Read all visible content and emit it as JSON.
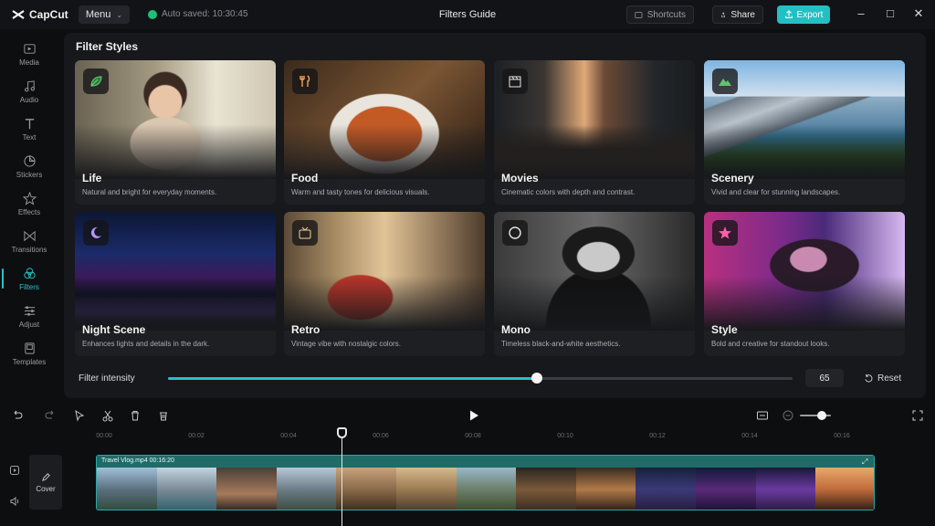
{
  "app": {
    "name": "CapCut",
    "title": "Filters Guide"
  },
  "topbar": {
    "menu_label": "Menu",
    "autosave": "Auto saved: 10:30:45",
    "shortcuts_label": "Shortcuts",
    "share_label": "Share",
    "export_label": "Export"
  },
  "sidebar": {
    "items": [
      {
        "label": "Media",
        "icon": "media-icon"
      },
      {
        "label": "Audio",
        "icon": "audio-icon"
      },
      {
        "label": "Text",
        "icon": "text-icon"
      },
      {
        "label": "Stickers",
        "icon": "stickers-icon"
      },
      {
        "label": "Effects",
        "icon": "effects-icon"
      },
      {
        "label": "Transitions",
        "icon": "transitions-icon"
      },
      {
        "label": "Filters",
        "icon": "filters-icon",
        "active": true
      },
      {
        "label": "Adjust",
        "icon": "adjust-icon"
      },
      {
        "label": "Templates",
        "icon": "templates-icon"
      }
    ]
  },
  "filters": {
    "heading": "Filter Styles",
    "cards": [
      {
        "name": "Life",
        "desc": "Natural and bright for everyday moments.",
        "icon": "leaf-icon"
      },
      {
        "name": "Food",
        "desc": "Warm and tasty tones for delicious visuals.",
        "icon": "fork-knife-icon"
      },
      {
        "name": "Movies",
        "desc": "Cinematic colors with depth and contrast.",
        "icon": "clapperboard-icon"
      },
      {
        "name": "Scenery",
        "desc": "Vivid and clear for stunning landscapes.",
        "icon": "mountain-icon"
      },
      {
        "name": "Night Scene",
        "desc": "Enhances lights and details in the dark.",
        "icon": "moon-icon"
      },
      {
        "name": "Retro",
        "desc": "Vintage vibe with nostalgic colors.",
        "icon": "retro-tv-icon"
      },
      {
        "name": "Mono",
        "desc": "Timeless black-and-white aesthetics.",
        "icon": "circle-icon"
      },
      {
        "name": "Style",
        "desc": "Bold and creative for standout looks.",
        "icon": "star-icon"
      }
    ]
  },
  "intensity": {
    "label": "Filter intensity",
    "value": "65",
    "level": 0.59,
    "reset_label": "Reset"
  },
  "timeline": {
    "ruler": [
      "00:00",
      "00:02",
      "00:04",
      "00:06",
      "00:08",
      "00:10",
      "00:12",
      "00:14",
      "00:16"
    ],
    "clip_label": "Travel Vlog.mp4   00:16:20",
    "cover_label": "Cover",
    "zoom_level": 0.7
  },
  "colors": {
    "accent": "#24c3c5",
    "export": "#23c0c3"
  }
}
